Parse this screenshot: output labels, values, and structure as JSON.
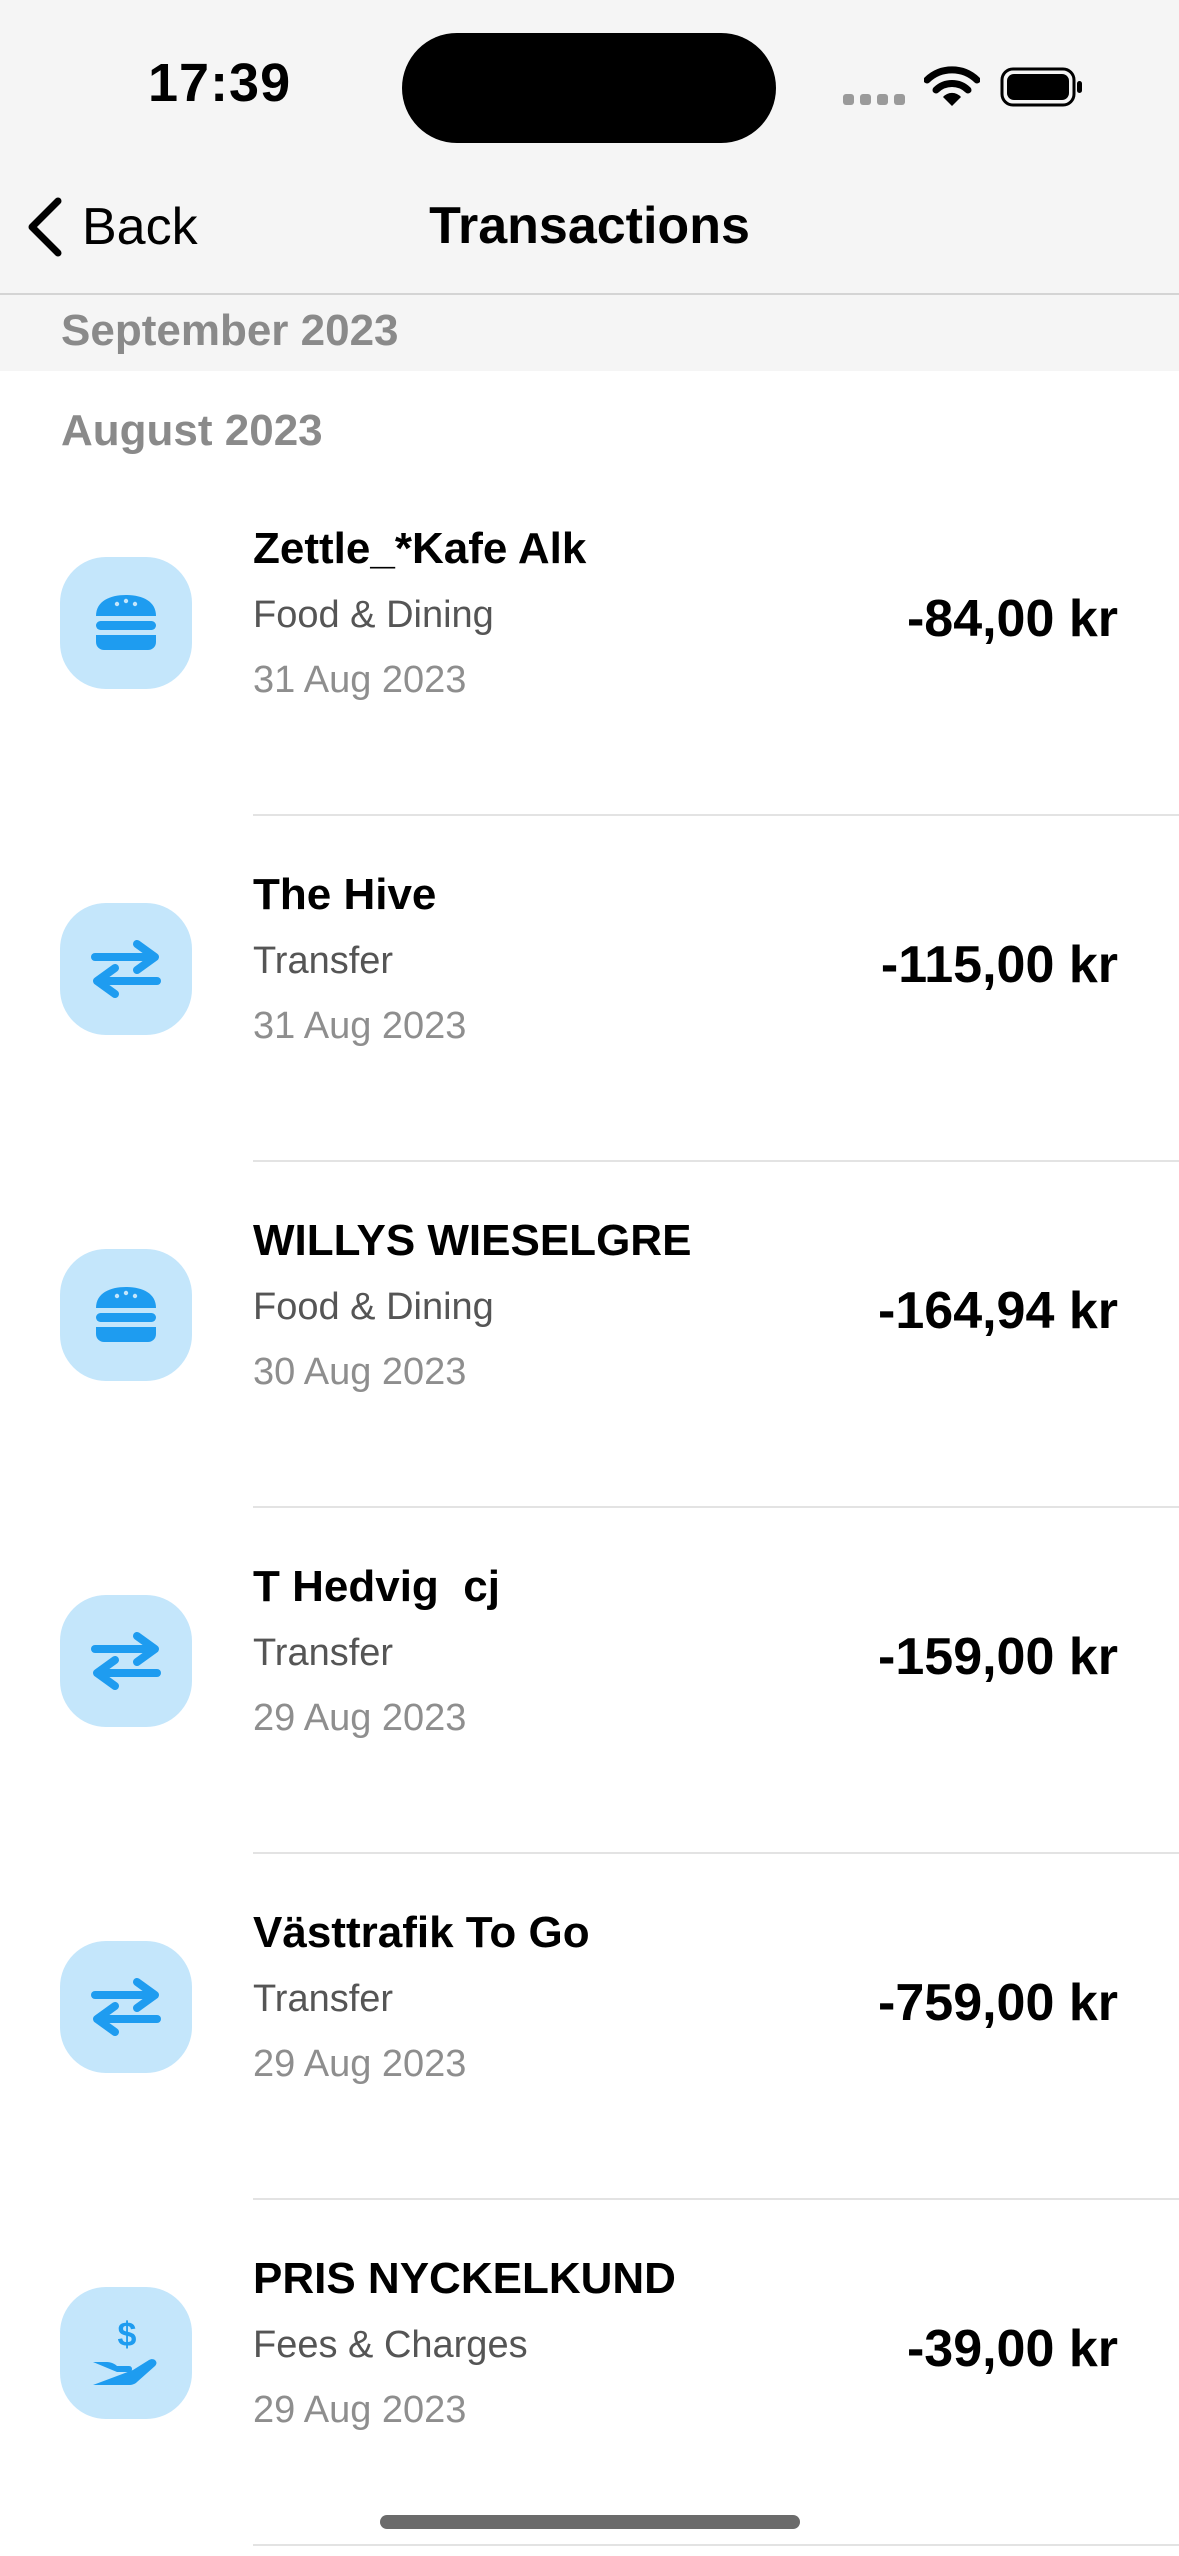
{
  "status_bar": {
    "time": "17:39"
  },
  "nav": {
    "back_label": "Back",
    "title": "Transactions"
  },
  "sections": [
    {
      "month": "September 2023"
    },
    {
      "month": "August 2023"
    }
  ],
  "transactions": [
    {
      "merchant": "Zettle_*Kafe Alk",
      "category": "Food & Dining",
      "date": "31 Aug 2023",
      "amount": "-84,00 kr",
      "icon": "burger-icon"
    },
    {
      "merchant": "The Hive",
      "category": "Transfer",
      "date": "31 Aug 2023",
      "amount": "-115,00 kr",
      "icon": "transfer-arrows-icon"
    },
    {
      "merchant": "WILLYS WIESELGRE",
      "category": "Food & Dining",
      "date": "30 Aug 2023",
      "amount": "-164,94 kr",
      "icon": "burger-icon"
    },
    {
      "merchant": "T Hedvig  cj",
      "category": "Transfer",
      "date": "29 Aug 2023",
      "amount": "-159,00 kr",
      "icon": "transfer-arrows-icon"
    },
    {
      "merchant": "Västtrafik To Go",
      "category": "Transfer",
      "date": "29 Aug 2023",
      "amount": "-759,00 kr",
      "icon": "transfer-arrows-icon"
    },
    {
      "merchant": "PRIS NYCKELKUND",
      "category": "Fees & Charges",
      "date": "29 Aug 2023",
      "amount": "-39,00 kr",
      "icon": "hand-dollar-icon"
    }
  ],
  "colors": {
    "icon_bg": "#c4e6fb",
    "icon_fg": "#1e9cf0",
    "muted": "#8a8a8a"
  }
}
